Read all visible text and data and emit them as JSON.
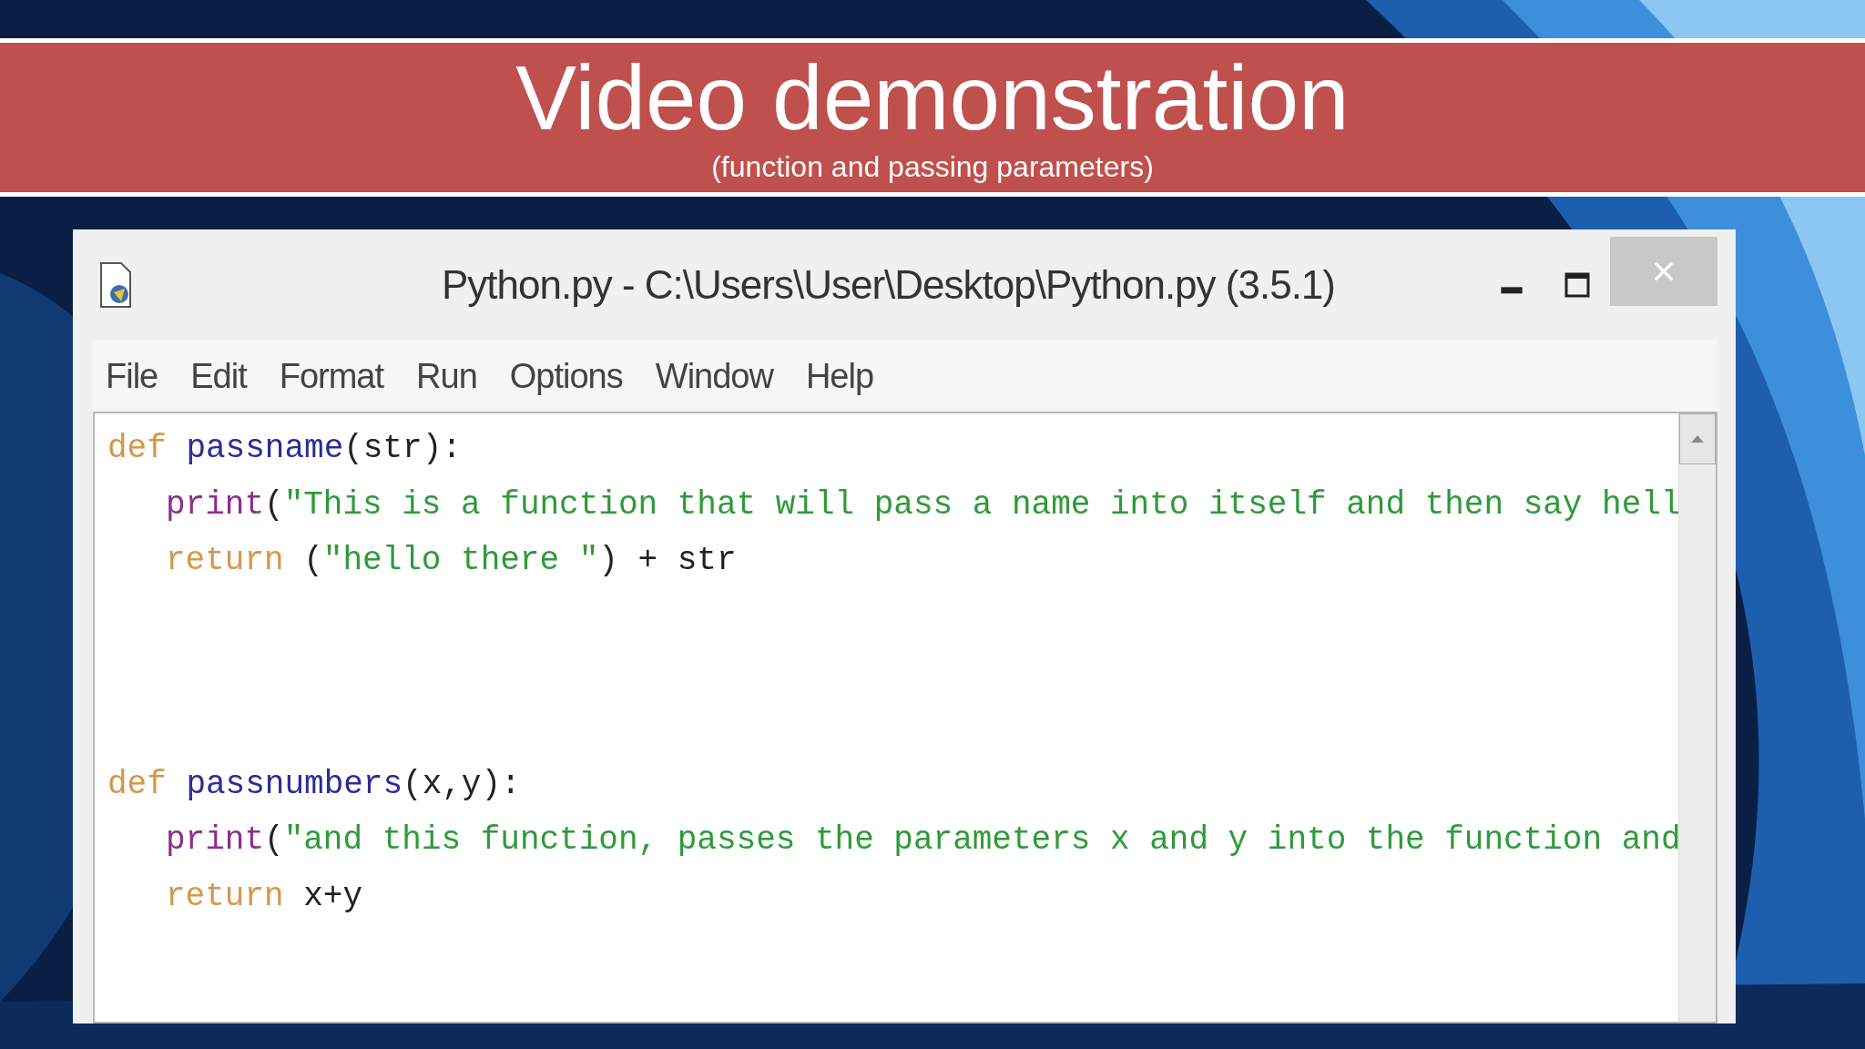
{
  "banner": {
    "title": "Video demonstration",
    "subtitle": "(function and passing parameters)"
  },
  "window": {
    "title": "Python.py - C:\\Users\\User\\Desktop\\Python.py (3.5.1)"
  },
  "menu": [
    "File",
    "Edit",
    "Format",
    "Run",
    "Options",
    "Window",
    "Help"
  ],
  "code_blocks": [
    [
      {
        "indented": false,
        "tokens": [
          {
            "kind": "keyword",
            "text": "def"
          },
          {
            "kind": "defname",
            "text": "passname"
          },
          {
            "kind": "plain",
            "text": "(str):"
          }
        ]
      },
      {
        "indented": true,
        "tokens": [
          {
            "kind": "builtin",
            "text": "print"
          },
          {
            "kind": "plain",
            "text": "("
          },
          {
            "kind": "string",
            "text": "\"This is a function that will pass a name into itself and then say hell"
          }
        ]
      },
      {
        "indented": true,
        "tokens": [
          {
            "kind": "keyword",
            "text": "return"
          },
          {
            "kind": "plain",
            "text": "("
          },
          {
            "kind": "string",
            "text": "\"hello there \""
          },
          {
            "kind": "plain",
            "text": ") + str"
          }
        ]
      }
    ],
    [
      {
        "indented": false,
        "tokens": [
          {
            "kind": "keyword",
            "text": "def"
          },
          {
            "kind": "defname",
            "text": "passnumbers"
          },
          {
            "kind": "plain",
            "text": "(x,y):"
          }
        ]
      },
      {
        "indented": true,
        "tokens": [
          {
            "kind": "builtin",
            "text": "print"
          },
          {
            "kind": "plain",
            "text": "("
          },
          {
            "kind": "string",
            "text": "\"and this function, passes the parameters x and y into the function and"
          }
        ]
      },
      {
        "indented": true,
        "tokens": [
          {
            "kind": "keyword",
            "text": "return"
          },
          {
            "kind": "plain",
            "text": "x+y"
          }
        ]
      }
    ]
  ]
}
